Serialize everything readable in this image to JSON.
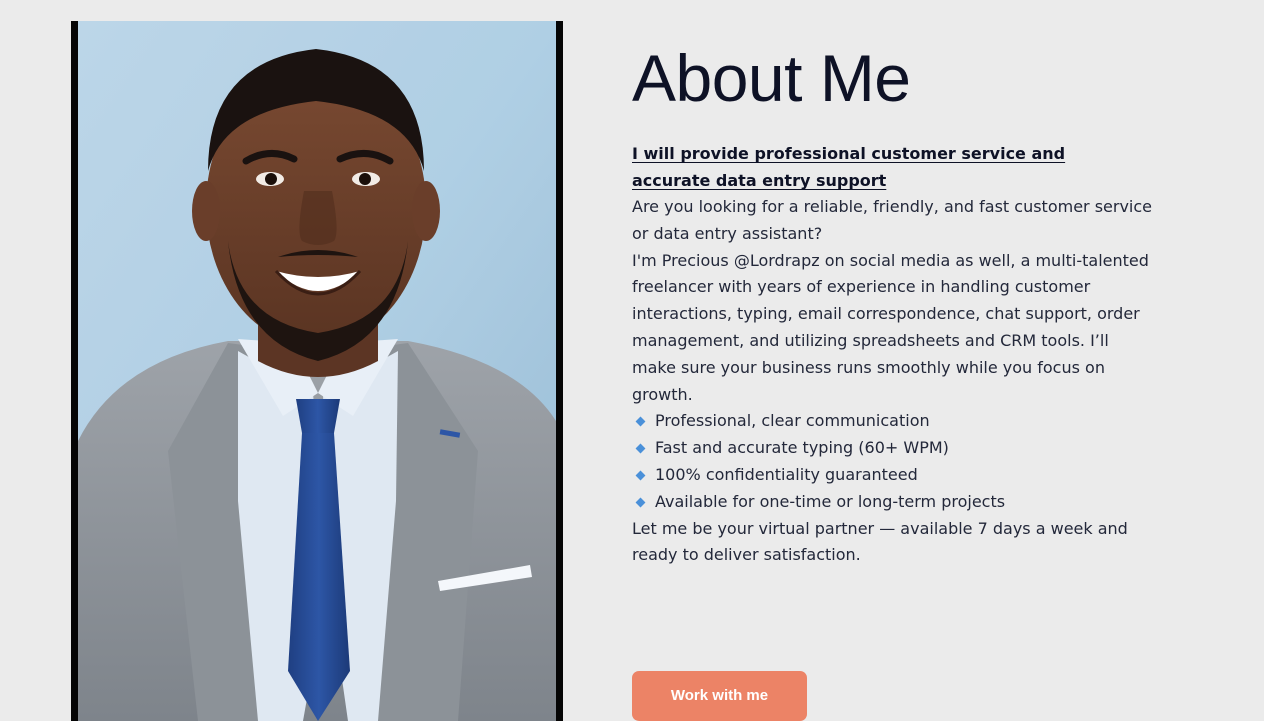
{
  "about": {
    "title": "About Me",
    "headline": "I will provide professional customer service and accurate data entry support",
    "intro": "Are you looking for a reliable, friendly, and fast customer service or data entry assistant?",
    "bio": "I'm Precious @Lordrapz on social media as well, a multi-talented freelancer with years of experience in handling customer interactions, typing, email correspondence, chat support, order management, and utilizing spreadsheets and CRM tools. I’ll make sure your business runs smoothly while you focus on growth.",
    "features": [
      "Professional, clear communication",
      "Fast and accurate typing (60+ WPM)",
      "100% confidentiality guaranteed",
      "Available for one-time or long-term projects"
    ],
    "closing": "Let me be your virtual partner — available 7 days a week and ready to deliver satisfaction.",
    "cta_label": "Work with me"
  },
  "colors": {
    "background": "#ebebeb",
    "cta": "#ec8366",
    "bullet": "#4a90d9",
    "title": "#0e1226"
  },
  "icons": {
    "bullet": "diamond-bullet-icon"
  }
}
